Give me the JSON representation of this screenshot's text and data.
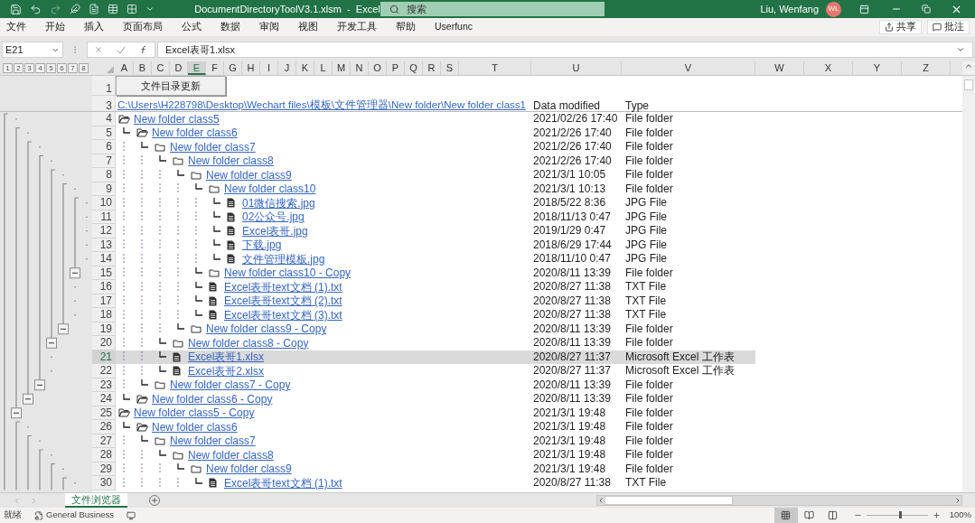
{
  "title_bar": {
    "document_title": "DocumentDirectoryToolV3.1.xlsm  -  Excel",
    "search_placeholder": "搜索",
    "user_name": "Liu, Wenfang",
    "avatar_initials": "WL"
  },
  "ribbon_tabs": [
    "文件",
    "开始",
    "插入",
    "页面布局",
    "公式",
    "数据",
    "审阅",
    "视图",
    "开发工具",
    "帮助",
    "Userfunc"
  ],
  "ribbon_buttons": [
    {
      "kind": "share",
      "label": "共享"
    },
    {
      "kind": "comment",
      "label": "批注"
    }
  ],
  "formula_bar": {
    "name_box": "E21",
    "value": "Excel表哥1.xlsx"
  },
  "outline_levels": [
    "1",
    "2",
    "3",
    "4",
    "5",
    "6",
    "7",
    "8"
  ],
  "columns": [
    {
      "label": "A",
      "selected": false
    },
    {
      "label": "B",
      "selected": false
    },
    {
      "label": "C",
      "selected": false
    },
    {
      "label": "D",
      "selected": false
    },
    {
      "label": "E",
      "selected": true
    },
    {
      "label": "F",
      "selected": false
    },
    {
      "label": "G",
      "selected": false
    },
    {
      "label": "H",
      "selected": false
    },
    {
      "label": "I",
      "selected": false
    },
    {
      "label": "J",
      "selected": false
    },
    {
      "label": "K",
      "selected": false
    },
    {
      "label": "L",
      "selected": false
    },
    {
      "label": "M",
      "selected": false
    },
    {
      "label": "N",
      "selected": false
    },
    {
      "label": "O",
      "selected": false
    },
    {
      "label": "P",
      "selected": false
    },
    {
      "label": "Q",
      "selected": false
    },
    {
      "label": "R",
      "selected": false
    },
    {
      "label": "S",
      "selected": false
    },
    {
      "label": "T",
      "selected": false
    },
    {
      "label": "U",
      "selected": false
    },
    {
      "label": "V",
      "selected": false
    },
    {
      "label": "W",
      "selected": false
    },
    {
      "label": "X",
      "selected": false
    },
    {
      "label": "Y",
      "selected": false
    },
    {
      "label": "Z",
      "selected": false
    }
  ],
  "header_rows": {
    "button_row": {
      "row": "1",
      "label": "文件目录更新"
    },
    "path_row": {
      "row": "3",
      "path": "C:\\Users\\H228798\\Desktop\\Wechart files\\模板\\文件管理器\\New folder\\New folder class1",
      "date_header": "Data modified",
      "type_header": "Type"
    }
  },
  "tree": [
    {
      "row": "4",
      "kind": "folder_open",
      "name": "New folder class5",
      "date": "2021/02/26 17:40",
      "type": "File folder",
      "selected": false,
      "children": [
        {
          "row": "5",
          "kind": "folder_open",
          "name": "New folder class6",
          "date": "2021/2/26 17:40",
          "type": "File folder",
          "selected": false,
          "children": [
            {
              "row": "6",
              "kind": "folder",
              "name": "New folder class7",
              "date": "2021/2/26 17:40",
              "type": "File folder",
              "selected": false,
              "children": [
                {
                  "row": "7",
                  "kind": "folder",
                  "name": "New folder class8",
                  "date": "2021/2/26 17:40",
                  "type": "File folder",
                  "selected": false,
                  "children": [
                    {
                      "row": "8",
                      "kind": "folder",
                      "name": "New folder class9",
                      "date": "2021/3/1 10:05",
                      "type": "File folder",
                      "selected": false,
                      "children": [
                        {
                          "row": "9",
                          "kind": "folder",
                          "name": "New folder class10",
                          "date": "2021/3/1 10:13",
                          "type": "File folder",
                          "selected": false,
                          "children": [
                            {
                              "row": "10",
                              "kind": "file",
                              "name": "01微信搜索.jpg",
                              "date": "2018/5/22 8:36",
                              "type": "JPG File",
                              "selected": false
                            },
                            {
                              "row": "11",
                              "kind": "file",
                              "name": "02公众号.jpg",
                              "date": "2018/11/13 0:47",
                              "type": "JPG File",
                              "selected": false
                            },
                            {
                              "row": "12",
                              "kind": "file",
                              "name": "Excel表哥.jpg",
                              "date": "2019/1/29 0:47",
                              "type": "JPG File",
                              "selected": false
                            },
                            {
                              "row": "13",
                              "kind": "file",
                              "name": "下载.jpg",
                              "date": "2018/6/29 17:44",
                              "type": "JPG File",
                              "selected": false
                            },
                            {
                              "row": "14",
                              "kind": "file",
                              "name": "文件管理模板.jpg",
                              "date": "2018/11/10 0:47",
                              "type": "JPG File",
                              "selected": false
                            }
                          ]
                        },
                        {
                          "row": "15",
                          "kind": "folder",
                          "name": "New folder class10 - Copy",
                          "date": "2020/8/11 13:39",
                          "type": "File folder",
                          "selected": false
                        },
                        {
                          "row": "16",
                          "kind": "file",
                          "name": "Excel表哥text文档 (1).txt",
                          "date": "2020/8/27 11:38",
                          "type": "TXT File",
                          "selected": false
                        },
                        {
                          "row": "17",
                          "kind": "file",
                          "name": "Excel表哥text文档 (2).txt",
                          "date": "2020/8/27 11:38",
                          "type": "TXT File",
                          "selected": false
                        },
                        {
                          "row": "18",
                          "kind": "file",
                          "name": "Excel表哥text文档 (3).txt",
                          "date": "2020/8/27 11:38",
                          "type": "TXT File",
                          "selected": false
                        }
                      ]
                    },
                    {
                      "row": "19",
                      "kind": "folder",
                      "name": "New folder class9 - Copy",
                      "date": "2020/8/11 13:39",
                      "type": "File folder",
                      "selected": false
                    }
                  ]
                },
                {
                  "row": "20",
                  "kind": "folder",
                  "name": "New folder class8 - Copy",
                  "date": "2020/8/11 13:39",
                  "type": "File folder",
                  "selected": false
                },
                {
                  "row": "21",
                  "kind": "file",
                  "name": "Excel表哥1.xlsx",
                  "date": "2020/8/27 11:37",
                  "type": "Microsoft Excel 工作表",
                  "selected": true
                },
                {
                  "row": "22",
                  "kind": "file",
                  "name": "Excel表哥2.xlsx",
                  "date": "2020/8/27 11:37",
                  "type": "Microsoft Excel 工作表",
                  "selected": false
                }
              ]
            },
            {
              "row": "23",
              "kind": "folder",
              "name": "New folder class7 - Copy",
              "date": "2020/8/11 13:39",
              "type": "File folder",
              "selected": false
            }
          ]
        },
        {
          "row": "24",
          "kind": "folder_open",
          "name": "New folder class6 - Copy",
          "date": "2020/8/11 13:39",
          "type": "File folder",
          "selected": false
        }
      ]
    },
    {
      "row": "25",
      "kind": "folder_open",
      "name": "New folder class5 - Copy",
      "date": "2021/3/1 19:48",
      "type": "File folder",
      "selected": false,
      "children": [
        {
          "row": "26",
          "kind": "folder_open",
          "name": "New folder class6",
          "date": "2021/3/1 19:48",
          "type": "File folder",
          "selected": false,
          "children": [
            {
              "row": "27",
              "kind": "folder",
              "name": "New folder class7",
              "date": "2021/3/1 19:48",
              "type": "File folder",
              "selected": false,
              "children": [
                {
                  "row": "28",
                  "kind": "folder",
                  "name": "New folder class8",
                  "date": "2021/3/1 19:48",
                  "type": "File folder",
                  "selected": false,
                  "children": [
                    {
                      "row": "29",
                      "kind": "folder",
                      "name": "New folder class9",
                      "date": "2021/3/1 19:48",
                      "type": "File folder",
                      "selected": false,
                      "children": [
                        {
                          "row": "30",
                          "kind": "file",
                          "name": "Excel表哥text文档 (1).txt",
                          "date": "2020/8/27 11:38",
                          "type": "TXT File",
                          "selected": false
                        }
                      ]
                    }
                  ]
                }
              ]
            }
          ]
        }
      ]
    }
  ],
  "sheet_tabs": [
    {
      "label": "文件浏览器",
      "selected": true
    }
  ],
  "status_bar": {
    "status": "就绪",
    "label": "General Business",
    "views": [
      {
        "kind": "normal",
        "selected": true
      },
      {
        "kind": "page_layout",
        "selected": false
      },
      {
        "kind": "page_break",
        "selected": false
      }
    ],
    "zoom_slider": {
      "level": 0.55
    },
    "zoom": "100%"
  }
}
